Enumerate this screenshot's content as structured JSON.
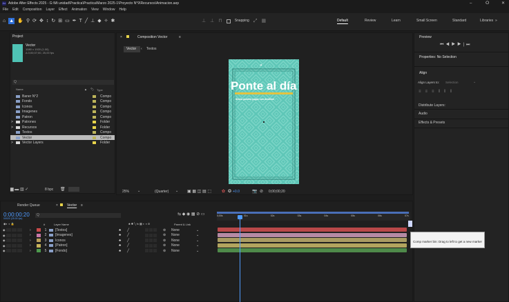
{
  "window": {
    "title": "Adobe After Effects 2025 - G:\\Mi unidad\\Practica\\Practica\\Marzo 2025-1\\Proyecto N°9\\Recursos\\Animacion.aep",
    "icon_text": "Ae",
    "min": "–",
    "restore": "ⵔ",
    "close": "✕"
  },
  "menu": [
    "File",
    "Edit",
    "Composition",
    "Layer",
    "Effect",
    "Animation",
    "View",
    "Window",
    "Help"
  ],
  "toolbar": {
    "snapping": "Snapping",
    "workspaces": [
      "Default",
      "Review",
      "Learn",
      "Small Screen",
      "Standard",
      "Libraries"
    ],
    "more": "»"
  },
  "project": {
    "title": "Project",
    "comp_name": "Vector",
    "comp_size": "1080 x 1920 (1.00)",
    "comp_dur": "Δ 0;00;07;00, 25,00 fps",
    "search_placeholder": "Q",
    "col_name": "Name",
    "col_type": "Type",
    "items": [
      {
        "name": "Baner N°2",
        "type": "Compo",
        "color": "#bdb45a",
        "expand": ""
      },
      {
        "name": "Fondo",
        "type": "Compo",
        "color": "#bdb45a",
        "expand": ""
      },
      {
        "name": "Iconos",
        "type": "Compo",
        "color": "#bdb45a",
        "expand": ""
      },
      {
        "name": "Imagenes",
        "type": "Compo",
        "color": "#bdb45a",
        "expand": ""
      },
      {
        "name": "Patron",
        "type": "Compo",
        "color": "#bdb45a",
        "expand": ""
      },
      {
        "name": "Patrones",
        "type": "Folder",
        "color": "#e7d34a",
        "expand": ">"
      },
      {
        "name": "Recursos",
        "type": "Folder",
        "color": "#e7d34a",
        "expand": ">"
      },
      {
        "name": "Textos",
        "type": "Compo",
        "color": "#bdb45a",
        "expand": ""
      },
      {
        "name": "Vector",
        "type": "Compo",
        "color": "#bdb45a",
        "expand": ""
      },
      {
        "name": "Vector Layers",
        "type": "Folder",
        "color": "#e7d34a",
        "expand": ">"
      }
    ],
    "bpc": "8 bpc"
  },
  "comp": {
    "tab": "Composition Vector",
    "breadcrumbs": [
      "Vector",
      "Textos"
    ],
    "headline": "Ponte al día",
    "subtitle": "Ahora puedes pagar con destiline",
    "zoom": "25%",
    "quality": "(Quarter)",
    "timecode": "0;00;00;20",
    "exposure": "+0.0"
  },
  "right": {
    "preview": "Preview",
    "properties": "Properties: No Selection",
    "align": "Align",
    "align_to_label": "Align Layers to:",
    "align_to_value": "Selection",
    "distribute": "Distribute Layers:",
    "audio": "Audio",
    "effects": "Effects & Presets"
  },
  "timeline": {
    "render_queue": "Render Queue",
    "tab": "Vector",
    "timecode": "0:00:00:20",
    "fps": "00020 (25.00 fps)",
    "search_placeholder": "Q",
    "col_name": "Layer Name",
    "col_parent": "Parent & Link",
    "col_num": "#",
    "layers": [
      {
        "num": "1",
        "name": "[Textos]",
        "parent": "None",
        "color": "#c84a4a",
        "track": "#b94849"
      },
      {
        "num": "2",
        "name": "[Imagenes]",
        "parent": "None",
        "color": "#c878a8",
        "track": "#b58aa4"
      },
      {
        "num": "3",
        "name": "Iconos",
        "parent": "None",
        "color": "#b9a05a",
        "track": "#a99b63"
      },
      {
        "num": "4",
        "name": "[Patron]",
        "parent": "None",
        "color": "#c9b45a",
        "track": "#b2a45e"
      },
      {
        "num": "5",
        "name": "[Fondo]",
        "parent": "None",
        "color": "#4d9a4d",
        "track": "#4f8a4a"
      }
    ],
    "ruler": [
      "0;00s",
      "01s",
      "02s",
      "03s",
      "04s",
      "05s",
      "06s",
      "07s"
    ],
    "tooltip": "Comp marker bin: Drag to left to get a new marker"
  }
}
